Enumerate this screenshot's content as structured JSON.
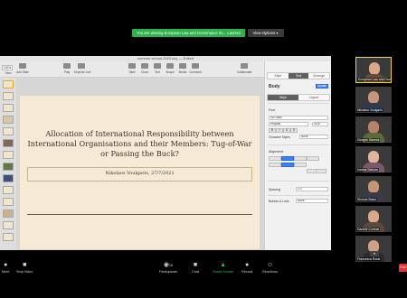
{
  "share_banner": {
    "message": "You are viewing European Law and Governance Sc... Laurent",
    "options_label": "View Options",
    "options_icon": "chevron-down-icon",
    "accent": "#2eb24b"
  },
  "keynote": {
    "title": "summer school 2020.key — Edited",
    "toolbar": {
      "zoom": "100%",
      "view": "View",
      "add_slide": "Add Slide",
      "play": "Play",
      "keynote_live": "Keynote Live",
      "table": "Table",
      "chart": "Chart",
      "text": "Text",
      "shape": "Shape",
      "media": "Media",
      "comment": "Comment",
      "collaborate": "Collaborate",
      "format": "Format",
      "animate": "Animate",
      "document": "Document"
    },
    "slide": {
      "title": "Allocation of International Responsibility between International Organisations and their Members: Tug-of-War or Passing the Buck?",
      "subtitle": "Nikolaos Voulgaris, 27/7/2021",
      "background": "#f5ebd5"
    },
    "inspector": {
      "tabs": [
        "Style",
        "Text",
        "Arrange"
      ],
      "active_tab": "Text",
      "paragraph_style": "Body",
      "update_label": "Update",
      "subtabs": [
        "Style",
        "Layout"
      ],
      "font_heading": "Font",
      "font_name": "Gill Sans",
      "font_style": "Regular",
      "font_size": "24 pt",
      "char_styles_label": "Character Styles",
      "char_styles_value": "None",
      "alignment_heading": "Alignment",
      "spacing_label": "Spacing",
      "spacing_value": "1.0",
      "bullets_label": "Bullets & Lists",
      "bullets_value": "None"
    }
  },
  "participants": [
    {
      "name": "European Law and Gove...",
      "speaking": true
    },
    {
      "name": "Nikolaos Voulgaris",
      "speaking": false
    },
    {
      "name": "Giorgos Stamos",
      "speaking": false
    },
    {
      "name": "Ioanna Stavrou",
      "speaking": false
    },
    {
      "name": "Simone Bassi",
      "speaking": false
    },
    {
      "name": "Daniele Cortese",
      "speaking": false
    },
    {
      "name": "Francesca Rossi",
      "speaking": false
    }
  ],
  "zoom_bar": {
    "mute": "Mute",
    "stop_video": "Stop Video",
    "participants": "Participants",
    "participants_count": "18",
    "chat": "Chat",
    "share_screen": "Share Screen",
    "record": "Record",
    "reactions": "Reactions",
    "end": "End",
    "share_color": "#26c33f"
  }
}
